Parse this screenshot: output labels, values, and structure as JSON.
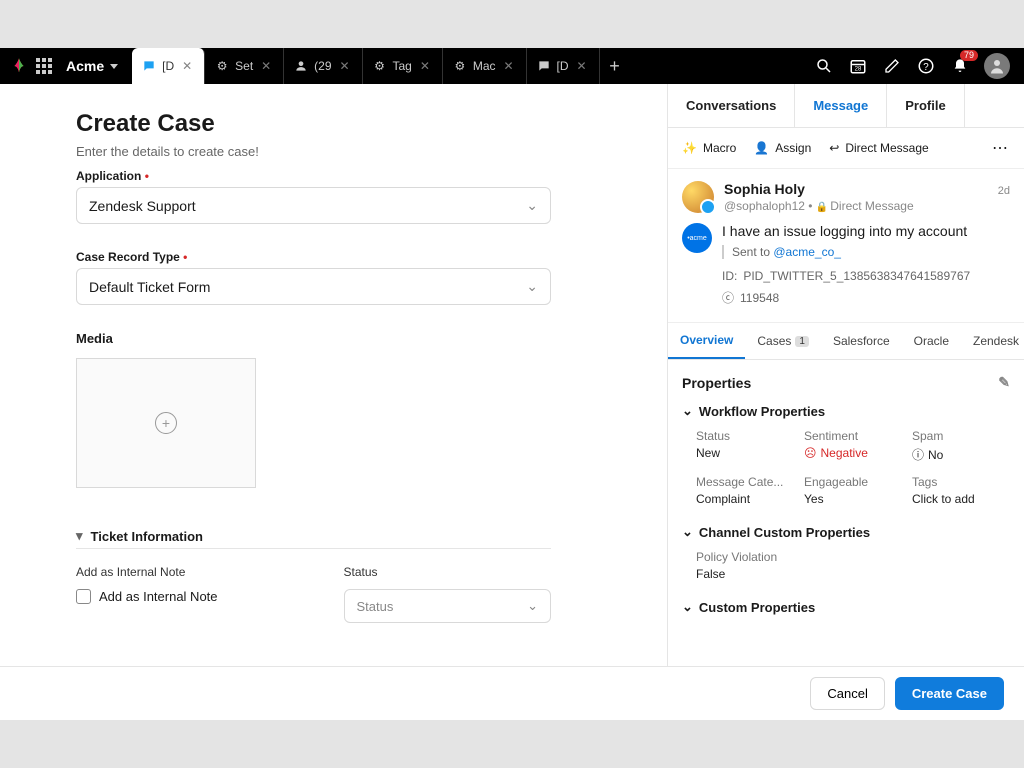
{
  "topbar": {
    "workspace": "Acme",
    "tabs": [
      {
        "label": "[D",
        "icon": "chat"
      },
      {
        "label": "Set",
        "icon": "gear"
      },
      {
        "label": "(29",
        "icon": "person"
      },
      {
        "label": "Tag",
        "icon": "gear"
      },
      {
        "label": "Mac",
        "icon": "gear"
      },
      {
        "label": "[D",
        "icon": "chat"
      }
    ],
    "notification_count": "79"
  },
  "create_case": {
    "title": "Create Case",
    "subtitle": "Enter the details to create case!",
    "application_label": "Application",
    "application_value": "Zendesk Support",
    "record_type_label": "Case Record Type",
    "record_type_value": "Default Ticket Form",
    "media_label": "Media",
    "section_ticket_info": "Ticket Information",
    "internal_note_label": "Add as Internal Note",
    "internal_note_checkbox": "Add as Internal Note",
    "status_label": "Status",
    "status_placeholder": "Status"
  },
  "right_panel": {
    "tabs": {
      "conversations": "Conversations",
      "message": "Message",
      "profile": "Profile"
    },
    "actions": {
      "macro": "Macro",
      "assign": "Assign",
      "dm": "Direct Message"
    },
    "message": {
      "name": "Sophia Holy",
      "time": "2d",
      "handle": "@sophaloph12",
      "channel": "Direct Message",
      "brand_label": "•acme",
      "text": "I have an issue logging into my account",
      "sent_to_prefix": "Sent to ",
      "sent_to": "@acme_co_",
      "id_label": "ID: ",
      "id_value": "PID_TWITTER_5_1385638347641589767",
      "case_num": "119548"
    },
    "subtabs": {
      "overview": "Overview",
      "cases": "Cases",
      "cases_count": "1",
      "salesforce": "Salesforce",
      "oracle": "Oracle",
      "zendesk": "Zendesk"
    },
    "properties": {
      "heading": "Properties",
      "workflow_hdr": "Workflow Properties",
      "status_l": "Status",
      "status_v": "New",
      "sentiment_l": "Sentiment",
      "sentiment_v": "Negative",
      "spam_l": "Spam",
      "spam_v": "No",
      "msgcat_l": "Message Cate...",
      "msgcat_v": "Complaint",
      "engage_l": "Engageable",
      "engage_v": "Yes",
      "tags_l": "Tags",
      "tags_v": "Click to add",
      "channel_hdr": "Channel Custom Properties",
      "policy_l": "Policy Violation",
      "policy_v": "False",
      "custom_hdr": "Custom Properties"
    }
  },
  "footer": {
    "cancel": "Cancel",
    "create": "Create Case"
  }
}
